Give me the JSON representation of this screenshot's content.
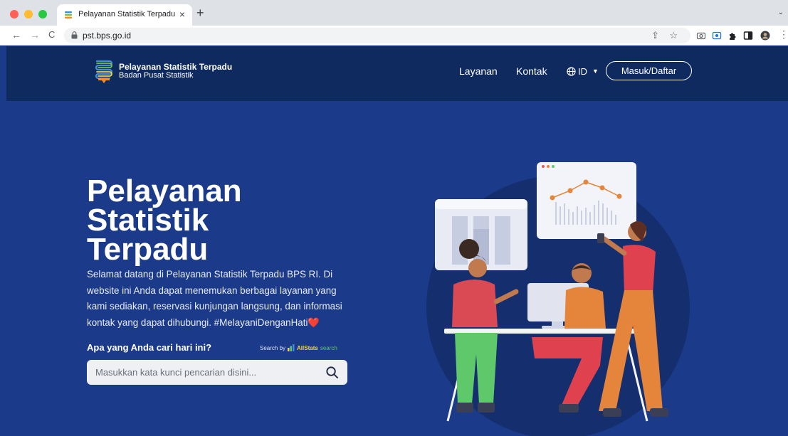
{
  "browser": {
    "tab_title": "Pelayanan Statistik Terpadu",
    "tab_close": "×",
    "new_tab": "+",
    "url": "pst.bps.go.id"
  },
  "header": {
    "logo_title": "Pelayanan Statistik Terpadu",
    "logo_subtitle": "Badan Pusat Statistik",
    "nav": {
      "layanan": "Layanan",
      "kontak": "Kontak"
    },
    "language": "ID",
    "login": "Masuk/Daftar"
  },
  "hero": {
    "title": "Pelayanan Statistik Terpadu",
    "description": "Selamat datang di Pelayanan Statistik Terpadu BPS RI. Di website ini Anda dapat menemukan berbagai layanan yang kami sediakan, reservasi kunjungan langsung, dan informasi kontak yang dapat dihubungi. #MelayaniDenganHati❤️",
    "search_question": "Apa yang Anda cari hari ini?",
    "search_by": "Search by",
    "allstats": "AllStats",
    "allstats_search": "search",
    "search_placeholder": "Masukkan kata kunci pencarian disini..."
  },
  "colors": {
    "header_bg": "#0f2a5e",
    "hero_bg": "#1b3a8a",
    "accent_orange": "#e5853b",
    "accent_red": "#e05a4f"
  }
}
